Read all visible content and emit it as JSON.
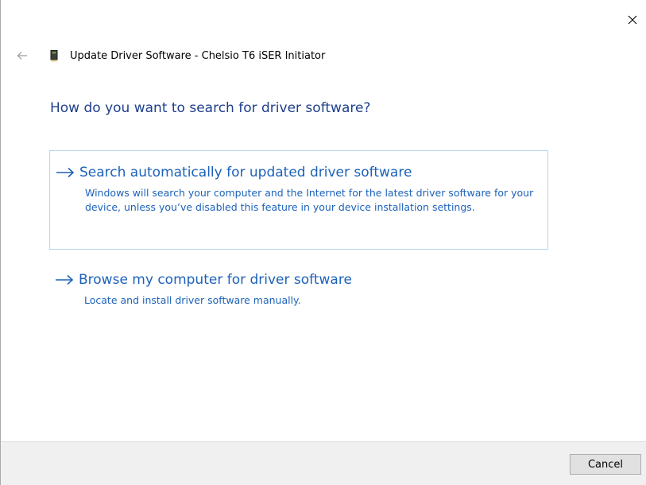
{
  "window": {
    "title": "Update Driver Software - Chelsio T6 iSER Initiator",
    "close_icon": "close-icon",
    "back_icon": "back-arrow-icon",
    "device_icon": "device-icon"
  },
  "page": {
    "heading": "How do you want to search for driver software?"
  },
  "options": [
    {
      "icon": "arrow-right-icon",
      "title": "Search automatically for updated driver software",
      "description": "Windows will search your computer and the Internet for the latest driver software for your device, unless you’ve disabled this feature in your device installation settings."
    },
    {
      "icon": "arrow-right-icon",
      "title": "Browse my computer for driver software",
      "description": "Locate and install driver software manually."
    }
  ],
  "footer": {
    "cancel_label": "Cancel"
  },
  "colors": {
    "heading": "#1e3f8b",
    "link": "#1c62b9",
    "option_border": "#b8d4ec",
    "footer_bg": "#f0f0f0"
  }
}
